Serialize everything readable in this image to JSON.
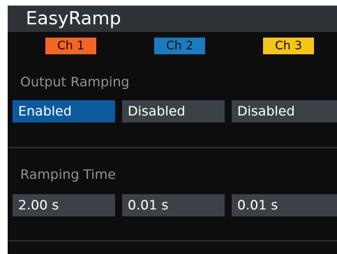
{
  "app": {
    "title": "EasyRamp"
  },
  "channels": [
    {
      "label": "Ch 1",
      "color": "#f26522"
    },
    {
      "label": "Ch 2",
      "color": "#1a7bbf"
    },
    {
      "label": "Ch 3",
      "color": "#f5c518"
    }
  ],
  "output_ramping": {
    "label": "Output Ramping",
    "values": [
      "Enabled",
      "Disabled",
      "Disabled"
    ],
    "selected_color": "#0b5a9e"
  },
  "ramping_time": {
    "label": "Ramping Time",
    "values": [
      "2.00 s",
      "0.01 s",
      "0.01 s"
    ]
  }
}
